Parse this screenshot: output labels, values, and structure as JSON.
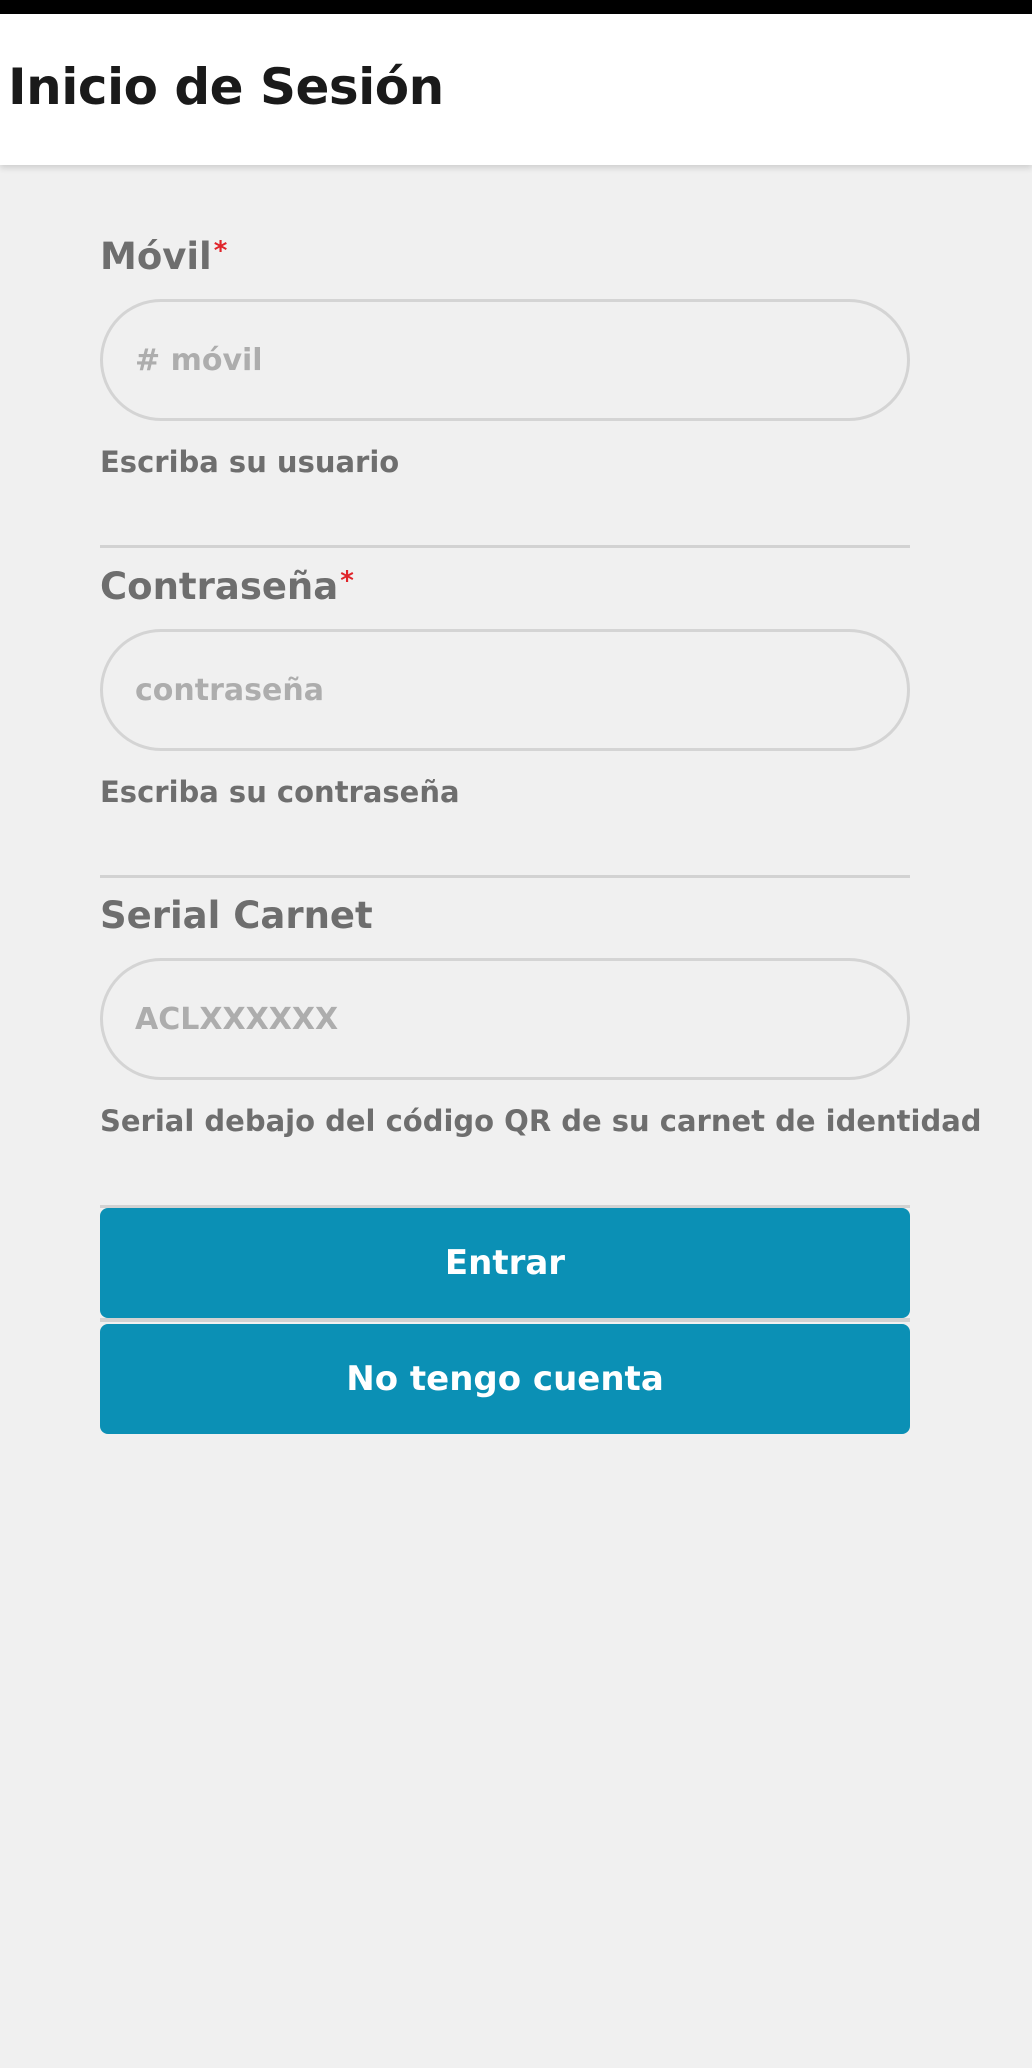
{
  "header": {
    "title": "Inicio de Sesión"
  },
  "form": {
    "mobile": {
      "label": "Móvil",
      "required_mark": "*",
      "placeholder": "# móvil",
      "value": "",
      "hint": "Escriba su usuario"
    },
    "password": {
      "label": "Contraseña",
      "required_mark": "*",
      "placeholder": "contraseña",
      "value": "",
      "hint": "Escriba su contraseña"
    },
    "serial": {
      "label": "Serial Carnet",
      "placeholder": "ACLXXXXXX",
      "value": "",
      "hint": "Serial debajo del código QR de su carnet de identidad"
    }
  },
  "buttons": {
    "login_label": "Entrar",
    "register_label": "No tengo cuenta"
  },
  "colors": {
    "primary": "#0b90b5",
    "required": "#e0242a",
    "background": "#f0f0f0",
    "header_bg": "#ffffff"
  }
}
